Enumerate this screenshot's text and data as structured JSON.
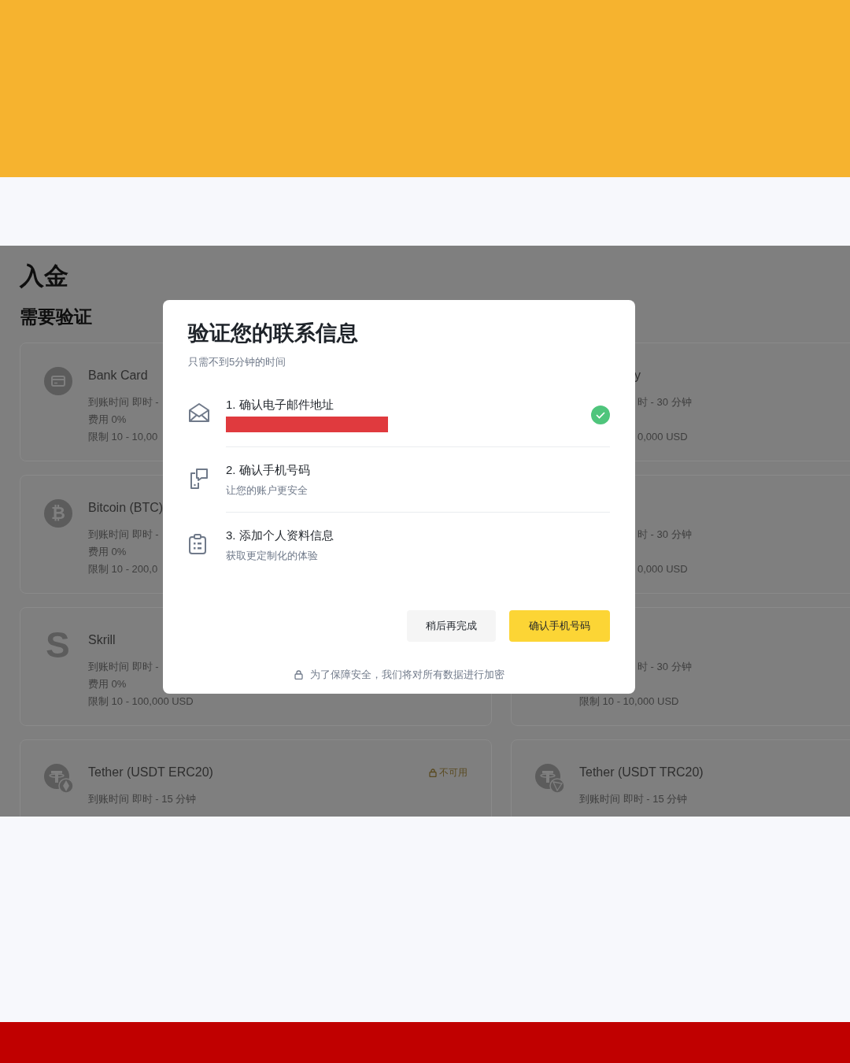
{
  "page": {
    "title": "入金",
    "section": "需要验证"
  },
  "left_methods": [
    {
      "name": "Bank Card",
      "lines": [
        "到账时间 即时 -",
        "费用 0%",
        "限制 10 - 10,00"
      ]
    },
    {
      "name": "Bitcoin (BTC)",
      "glyph": "₿",
      "lines": [
        "到账时间 即时 -",
        "费用 0%",
        "限制 10 - 200,0"
      ]
    },
    {
      "name": "Skrill",
      "glyph": "S",
      "lines": [
        "到账时间 即时 -",
        "费用 0%",
        "限制 10 - 100,000 USD"
      ]
    },
    {
      "name": "Tether (USDT ERC20)",
      "badge": "不可用",
      "lines": [
        "到账时间 即时 - 15 分钟"
      ]
    }
  ],
  "right_methods": [
    {
      "name": "y",
      "lines": [
        {
          "text": "时 - 30 分钟",
          "kind": "cut"
        },
        {
          "text": "0,000 USD",
          "kind": "cut"
        }
      ]
    },
    {
      "lines": [
        {
          "text": "时 - 30 分钟",
          "kind": "cut"
        },
        {
          "text": "0,000 USD",
          "kind": "cut"
        }
      ]
    },
    {
      "lines": [
        {
          "text": "时 - 30 分钟",
          "kind": "cut"
        },
        {
          "text": "限制 10 - 10,000 USD",
          "kind": "full"
        }
      ]
    },
    {
      "name": "Tether (USDT TRC20)",
      "lines": [
        {
          "text": "到账时间 即时 - 15 分钟",
          "kind": "full"
        }
      ]
    }
  ],
  "modal": {
    "title": "验证您的联系信息",
    "subtitle": "只需不到5分钟的时间",
    "steps": [
      {
        "title": "1. 确认电子邮件地址",
        "redacted": true,
        "completed": true
      },
      {
        "title": "2. 确认手机号码",
        "subtitle": "让您的账户更安全",
        "completed": false
      },
      {
        "title": "3. 添加个人资料信息",
        "subtitle": "获取更定制化的体验",
        "completed": false
      }
    ],
    "buttons": [
      {
        "label": "稍后再完成",
        "kind": "secondary"
      },
      {
        "label": "确认手机号码",
        "kind": "primary"
      }
    ],
    "footer": "为了保障安全，我们将对所有数据进行加密"
  }
}
